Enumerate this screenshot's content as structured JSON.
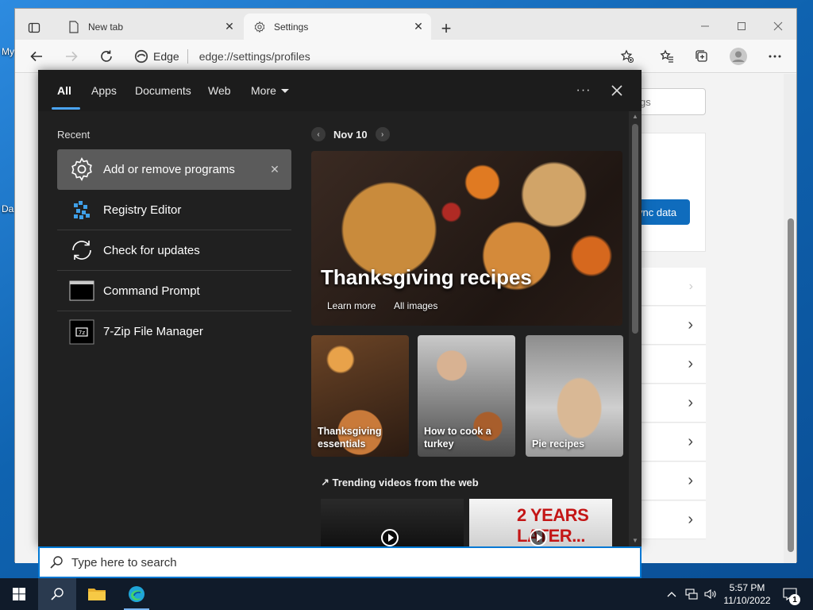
{
  "desktop": {
    "icon_labels": [
      "My",
      "Da"
    ]
  },
  "browser": {
    "tabs": [
      {
        "title": "New tab",
        "icon": "new-tab-page-icon",
        "active": false
      },
      {
        "title": "Settings",
        "icon": "gear-icon",
        "active": true
      }
    ],
    "address": {
      "badge": "Edge",
      "url": "edge://settings/profiles"
    },
    "settings_page": {
      "search_placeholder": "gs",
      "sync_button": "ync data"
    }
  },
  "search_panel": {
    "tabs": [
      {
        "label": "All",
        "active": true
      },
      {
        "label": "Apps",
        "active": false
      },
      {
        "label": "Documents",
        "active": false
      },
      {
        "label": "Web",
        "active": false
      },
      {
        "label": "More",
        "active": false
      }
    ],
    "recent_heading": "Recent",
    "recent": [
      {
        "label": "Add or remove programs",
        "icon": "gear-icon",
        "selected": true
      },
      {
        "label": "Registry Editor",
        "icon": "registry-editor-icon",
        "selected": false
      },
      {
        "label": "Check for updates",
        "icon": "refresh-icon",
        "selected": false
      },
      {
        "label": "Command Prompt",
        "icon": "command-prompt-icon",
        "selected": false
      },
      {
        "label": "7-Zip File Manager",
        "icon": "7zip-icon",
        "selected": false
      }
    ],
    "date": "Nov 10",
    "hero": {
      "title": "Thanksgiving recipes",
      "links": [
        "Learn more",
        "All images"
      ]
    },
    "cards": [
      {
        "label": "Thanksgiving essentials"
      },
      {
        "label": "How to cook a turkey"
      },
      {
        "label": "Pie recipes"
      }
    ],
    "trending_heading": "Trending videos from the web",
    "videos": [
      {
        "overlay_text": ""
      },
      {
        "overlay_text": "2 YEARS LATER..."
      }
    ]
  },
  "searchbox": {
    "placeholder": "Type here to search"
  },
  "taskbar": {
    "time": "5:57 PM",
    "date": "11/10/2022",
    "notification_count": "1"
  },
  "colors": {
    "accent": "#0078d4",
    "panel_bg": "#202020",
    "taskbar_bg": "#101b2a"
  }
}
